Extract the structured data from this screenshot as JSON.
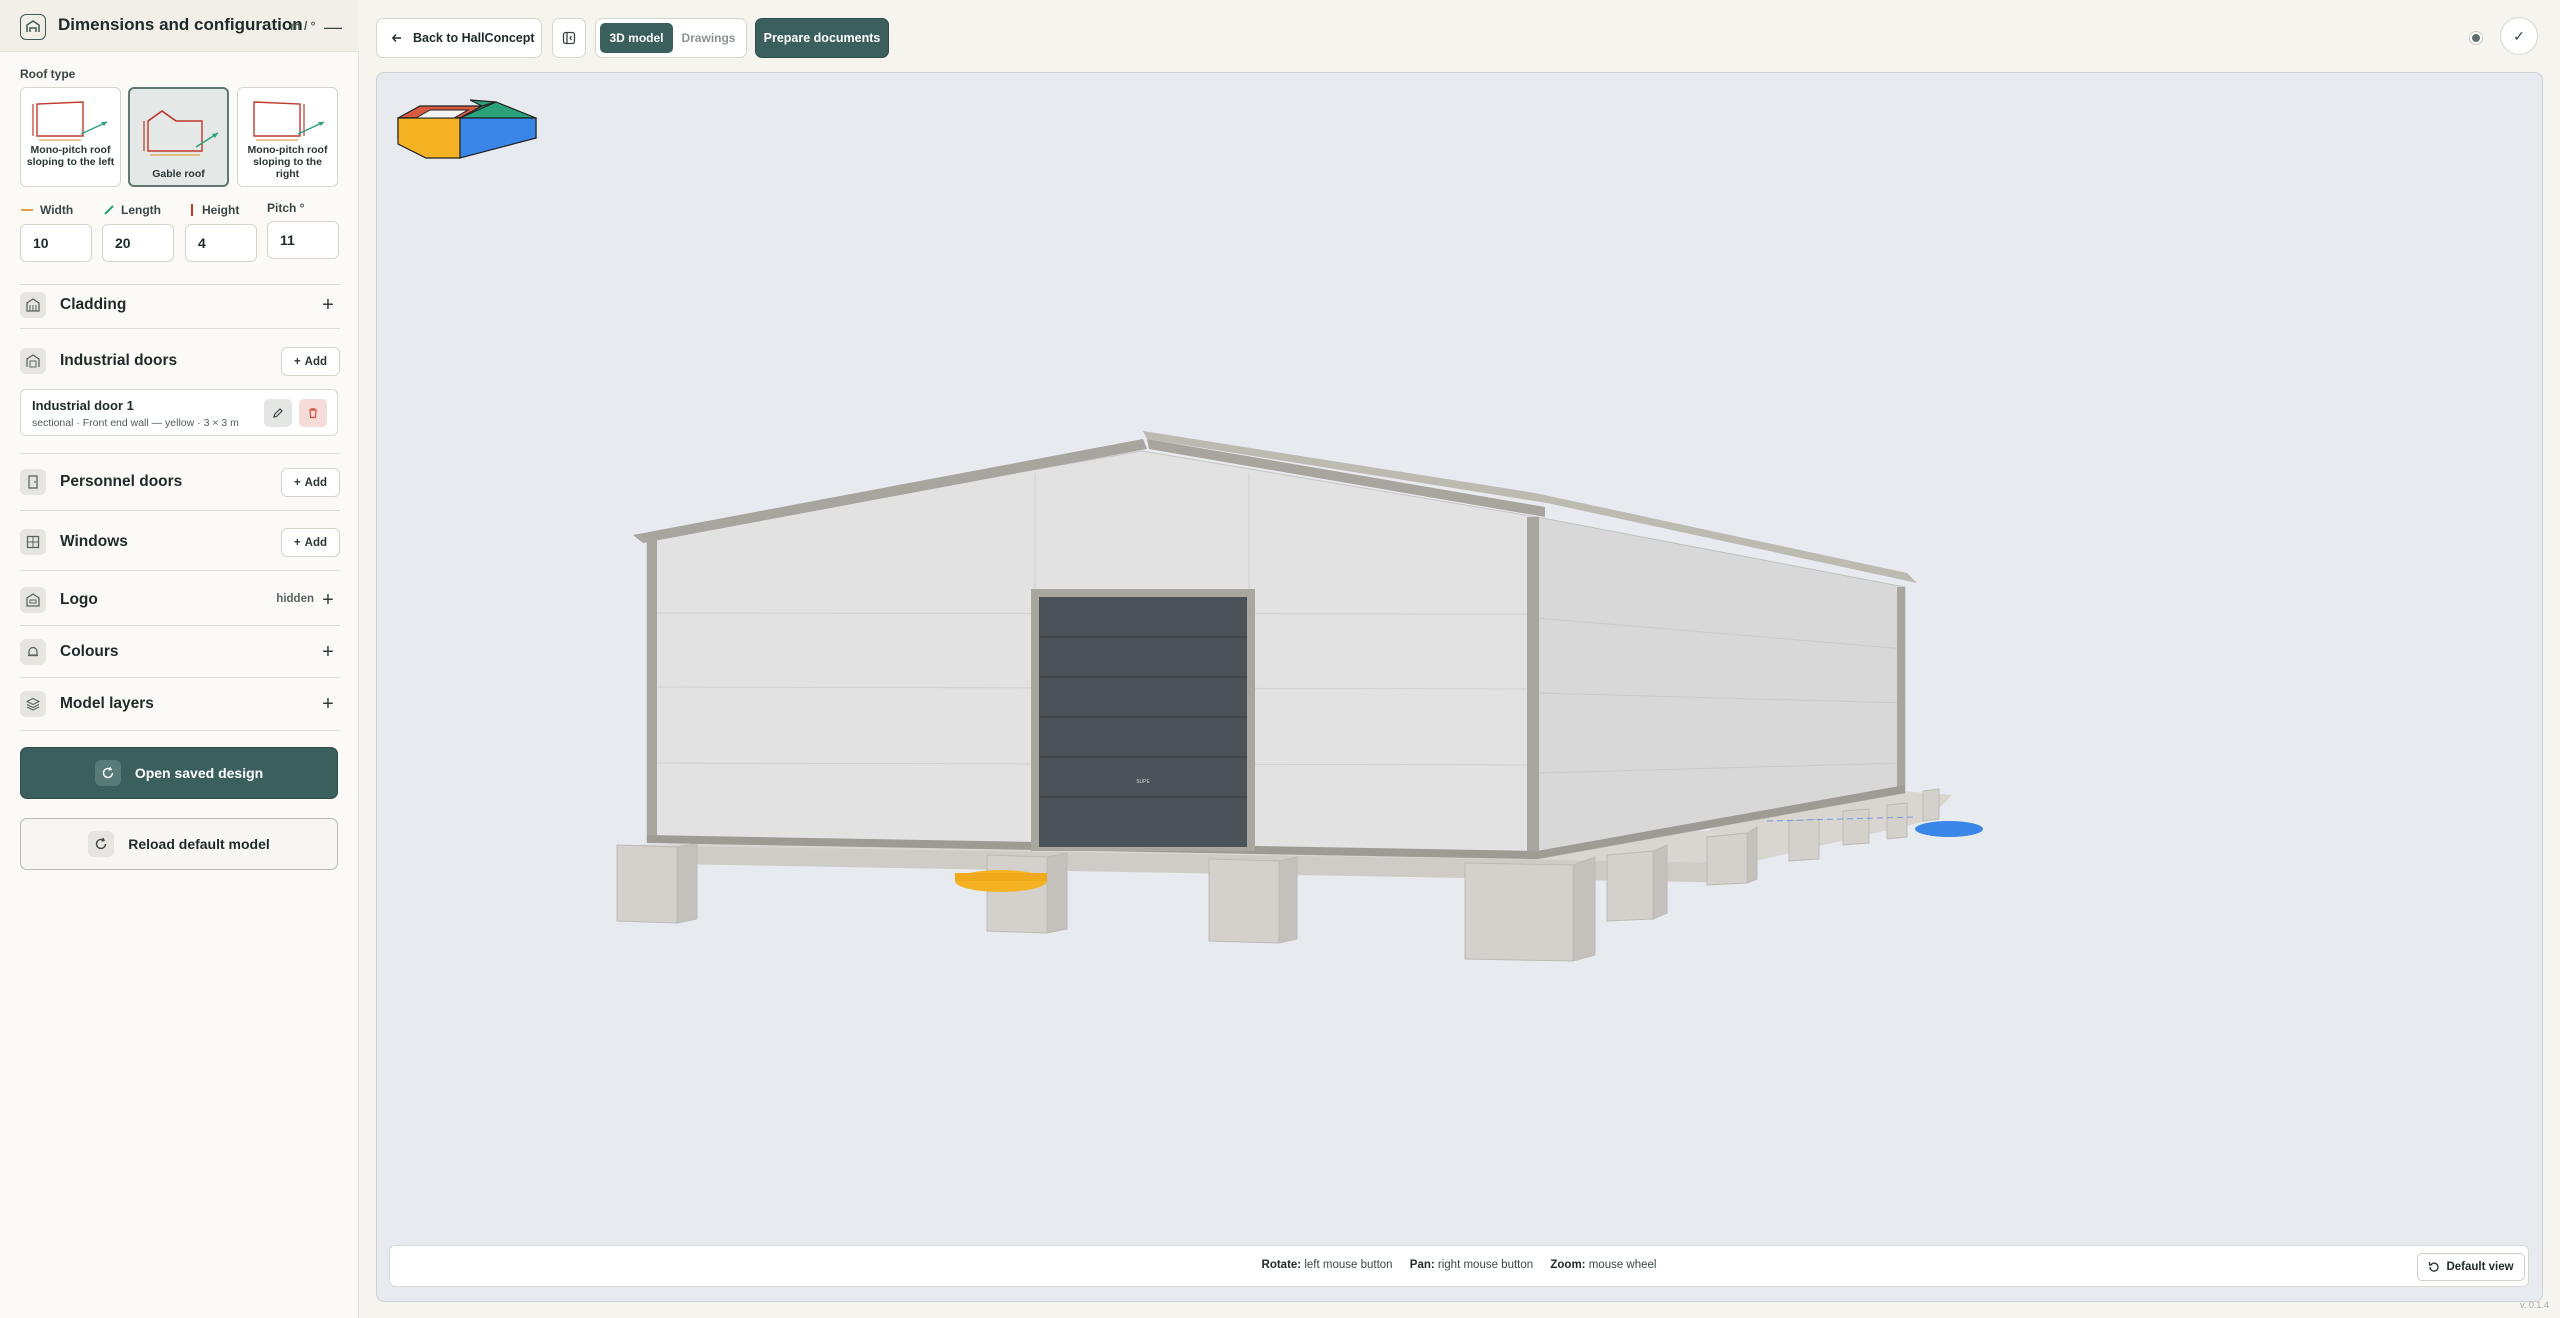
{
  "sidebar": {
    "header": {
      "title": "Dimensions and configuration",
      "unit": "m / °",
      "collapse": "—"
    },
    "roof_type_label": "Roof type",
    "roof_types": [
      {
        "label": "Mono-pitch roof sloping to the left",
        "selected": false
      },
      {
        "label": "Gable roof",
        "selected": true
      },
      {
        "label": "Mono-pitch roof sloping to the right",
        "selected": false
      }
    ],
    "dimensions": {
      "width": {
        "label": "Width",
        "value": "10"
      },
      "length": {
        "label": "Length",
        "value": "20"
      },
      "height": {
        "label": "Height",
        "value": "4"
      },
      "pitch": {
        "label": "Pitch °",
        "value": "11"
      }
    },
    "sections": {
      "cladding": {
        "title": "Cladding",
        "toggle": "+"
      },
      "industrial_doors": {
        "title": "Industrial doors",
        "add": "Add"
      },
      "personnel_doors": {
        "title": "Personnel doors",
        "add": "Add"
      },
      "windows": {
        "title": "Windows",
        "add": "Add"
      },
      "logo": {
        "title": "Logo",
        "state": "hidden",
        "toggle": "+"
      },
      "colours": {
        "title": "Colours",
        "toggle": "+"
      },
      "model_layers": {
        "title": "Model layers",
        "toggle": "+"
      }
    },
    "industrial_door_items": [
      {
        "title": "Industrial door 1",
        "subtitle": "sectional · Front end wall — yellow · 3 × 3 m"
      }
    ],
    "open_saved_label": "Open saved design",
    "reload_default_label": "Reload default model"
  },
  "topbar": {
    "back_label": "Back to HallConcept",
    "view_tabs": {
      "model": "3D model",
      "drawings": "Drawings",
      "active": "3D model"
    },
    "prepare_label": "Prepare documents",
    "confirm_icon": "✓"
  },
  "viewport": {
    "door_label": "SUPE",
    "hints": {
      "rotate_key": "Rotate:",
      "rotate_val": "left mouse button",
      "pan_key": "Pan:",
      "pan_val": "right mouse button",
      "zoom_key": "Zoom:",
      "zoom_val": "mouse wheel"
    },
    "default_view_label": "Default view",
    "version": "v. 0.1.4"
  },
  "colors": {
    "accent": "#3b5f5c",
    "front_marker": "#f5b324",
    "side_marker": "#3a86e8",
    "door": "#4c5358",
    "delete_red": "#d9503f"
  },
  "icons": [
    "hall-icon",
    "cladding-icon",
    "door-icon",
    "personnel-door-icon",
    "window-icon",
    "logo-icon",
    "bell-icon",
    "layers-icon",
    "pencil-icon",
    "trash-icon",
    "arrow-left-icon",
    "refresh-icon",
    "check-icon"
  ]
}
